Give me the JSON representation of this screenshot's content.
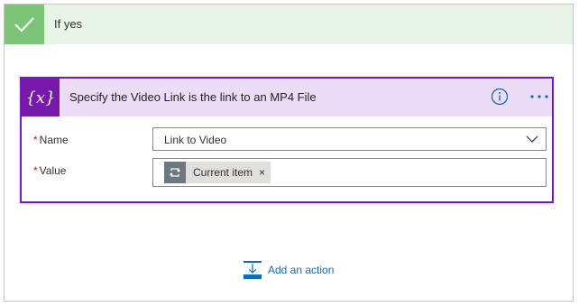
{
  "branch": {
    "title": "If yes",
    "check_color": "#7cc576",
    "header_bg": "#e8f4e8"
  },
  "action_card": {
    "icon_text": "{x}",
    "title": "Specify the Video Link is the link to an MP4 File",
    "accent": "#7719aa",
    "header_bg": "#ecdcf7",
    "info_icon": "info-icon",
    "more_icon": "ellipsis-icon",
    "fields": {
      "name": {
        "required_mark": "*",
        "label": "Name",
        "value": "Link to Video"
      },
      "value": {
        "required_mark": "*",
        "label": "Value",
        "token": {
          "icon": "loop-icon",
          "label": "Current item",
          "remove": "×"
        }
      }
    }
  },
  "add_action": {
    "label": "Add an action",
    "color": "#0f6cbd"
  }
}
